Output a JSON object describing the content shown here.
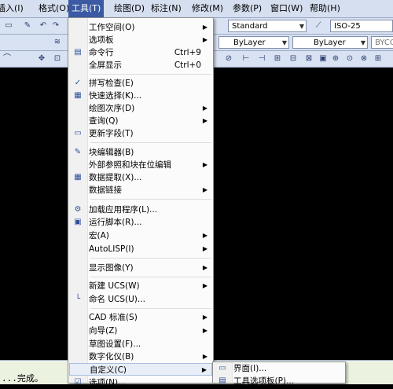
{
  "menubar": {
    "items": [
      {
        "label": "插入(I)",
        "active": false
      },
      {
        "label": "格式(O)",
        "active": false
      },
      {
        "label": "工具(T)",
        "active": true
      },
      {
        "label": "绘图(D)",
        "active": false
      },
      {
        "label": "标注(N)",
        "active": false
      },
      {
        "label": "修改(M)",
        "active": false
      },
      {
        "label": "参数(P)",
        "active": false
      },
      {
        "label": "窗口(W)",
        "active": false
      },
      {
        "label": "帮助(H)",
        "active": false
      }
    ]
  },
  "toolbar": {
    "text_style": "Standard",
    "dim_style": "ISO-25",
    "layer_color": "ByLayer",
    "layer_linetype": "ByLayer",
    "plot_style": "BYCOLO"
  },
  "tools_menu": {
    "items": [
      {
        "label": "工作空间(O)",
        "shortcut": "",
        "submenu": true,
        "icon": ""
      },
      {
        "label": "选项板",
        "shortcut": "",
        "submenu": true,
        "icon": ""
      },
      {
        "label": "命令行",
        "shortcut": "Ctrl+9",
        "submenu": false,
        "icon": "command-line-icon"
      },
      {
        "label": "全屏显示",
        "shortcut": "Ctrl+0",
        "submenu": false,
        "icon": ""
      },
      {
        "label": "拼写检查(E)",
        "shortcut": "",
        "submenu": false,
        "icon": "spell-check-icon"
      },
      {
        "label": "快速选择(K)...",
        "shortcut": "",
        "submenu": false,
        "icon": "quick-select-icon"
      },
      {
        "label": "绘图次序(D)",
        "shortcut": "",
        "submenu": true,
        "icon": ""
      },
      {
        "label": "查询(Q)",
        "shortcut": "",
        "submenu": true,
        "icon": ""
      },
      {
        "label": "更新字段(T)",
        "shortcut": "",
        "submenu": false,
        "icon": "update-field-icon"
      },
      {
        "label": "块编辑器(B)",
        "shortcut": "",
        "submenu": false,
        "icon": "block-editor-icon"
      },
      {
        "label": "外部参照和块在位编辑",
        "shortcut": "",
        "submenu": true,
        "icon": ""
      },
      {
        "label": "数据提取(X)...",
        "shortcut": "",
        "submenu": false,
        "icon": "data-extract-icon"
      },
      {
        "label": "数据链接",
        "shortcut": "",
        "submenu": true,
        "icon": ""
      },
      {
        "label": "加载应用程序(L)...",
        "shortcut": "",
        "submenu": false,
        "icon": "load-app-icon"
      },
      {
        "label": "运行脚本(R)...",
        "shortcut": "",
        "submenu": false,
        "icon": "run-script-icon"
      },
      {
        "label": "宏(A)",
        "shortcut": "",
        "submenu": true,
        "icon": ""
      },
      {
        "label": "AutoLISP(I)",
        "shortcut": "",
        "submenu": true,
        "icon": ""
      },
      {
        "label": "显示图像(Y)",
        "shortcut": "",
        "submenu": true,
        "icon": ""
      },
      {
        "label": "新建 UCS(W)",
        "shortcut": "",
        "submenu": true,
        "icon": ""
      },
      {
        "label": "命名 UCS(U)...",
        "shortcut": "",
        "submenu": false,
        "icon": "named-ucs-icon"
      },
      {
        "label": "CAD 标准(S)",
        "shortcut": "",
        "submenu": true,
        "icon": ""
      },
      {
        "label": "向导(Z)",
        "shortcut": "",
        "submenu": true,
        "icon": ""
      },
      {
        "label": "草图设置(F)...",
        "shortcut": "",
        "submenu": false,
        "icon": ""
      },
      {
        "label": "数字化仪(B)",
        "shortcut": "",
        "submenu": true,
        "icon": ""
      },
      {
        "label": "自定义(C)",
        "shortcut": "",
        "submenu": true,
        "icon": ""
      },
      {
        "label": "选项(N)...",
        "shortcut": "",
        "submenu": false,
        "icon": "options-icon"
      }
    ]
  },
  "customize_submenu": {
    "items": [
      {
        "label": "界面(I)...",
        "icon": "interface-icon"
      },
      {
        "label": "工具选项板(P)...",
        "icon": "tool-palette-icon"
      }
    ]
  },
  "command_line": {
    "text": "...完成。"
  },
  "colors": {
    "menu_highlight": "#3b5aa3",
    "canvas": "#000000",
    "menu_bg": "#fbfbfb"
  }
}
